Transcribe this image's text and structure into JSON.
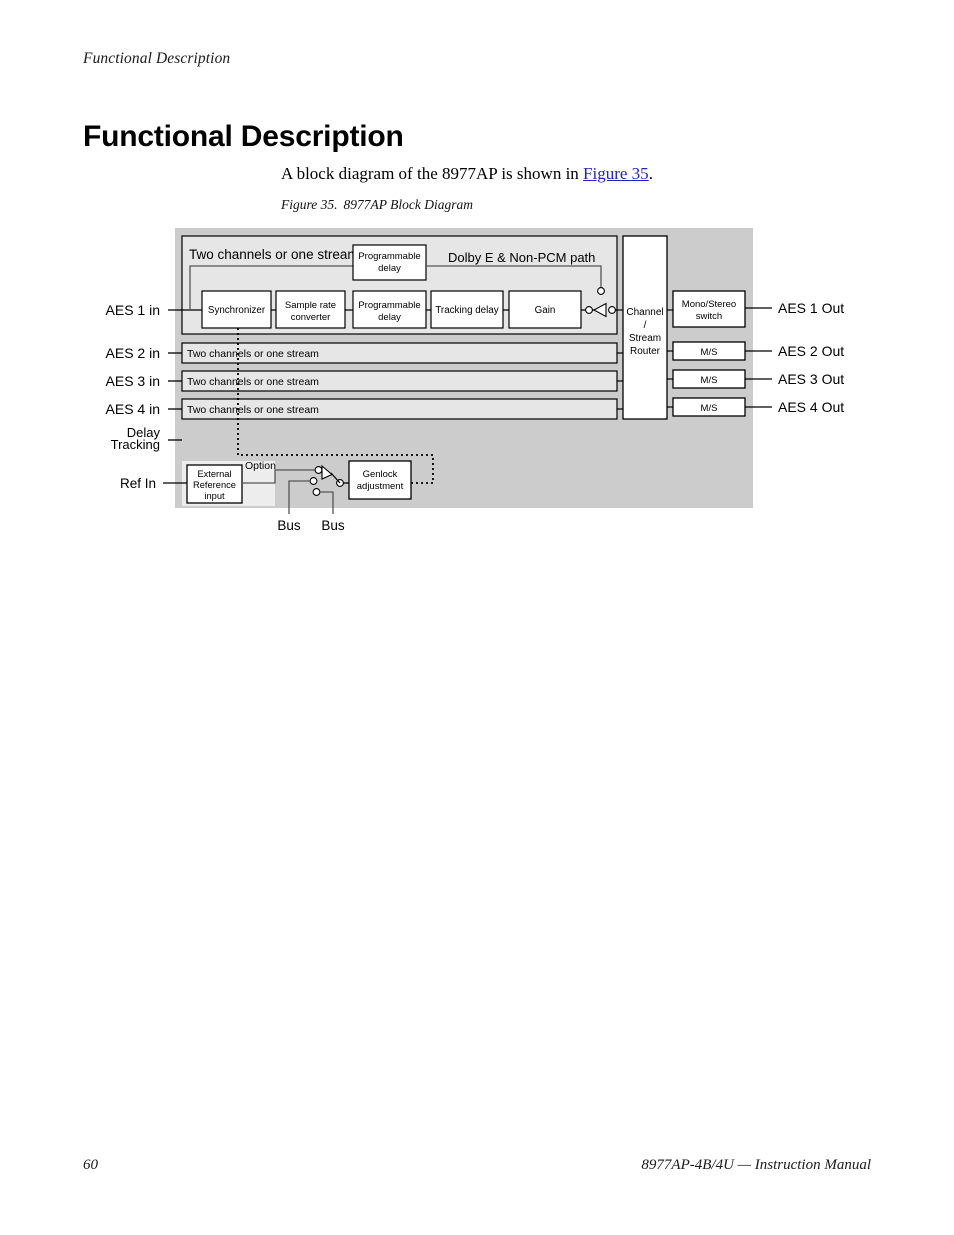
{
  "page": {
    "running_head": "Functional Description",
    "chapter_title": "Functional Description",
    "body_text_before": "A block diagram of the 8977AP is shown in ",
    "body_xref": "Figure 35",
    "body_text_after": ".",
    "caption_number": "Figure 35.",
    "caption_text": "8977AP Block Diagram",
    "footer_page_number": "60",
    "footer_title": "8977AP-4B/4U — Instruction Manual"
  },
  "colors": {
    "panel_gray": "#cccccc",
    "channel_gray": "#e6e6e6",
    "option_gray": "#ededed",
    "block_fill": "#ffffff",
    "line": "#000000",
    "soft_line": "#555555",
    "xref_blue": "#2222cc"
  },
  "diagram": {
    "title": "8977AP Block Diagram",
    "inputs": [
      {
        "label": "AES 1 in"
      },
      {
        "label": "AES 2 in"
      },
      {
        "label": "AES 3 in"
      },
      {
        "label": "AES 4 in"
      }
    ],
    "delay_tracking_label_line1": "Delay",
    "delay_tracking_label_line2": "Tracking",
    "ref_in_label": "Ref In",
    "outputs": [
      {
        "label": "AES 1 Out"
      },
      {
        "label": "AES 2 Out"
      },
      {
        "label": "AES 3 Out"
      },
      {
        "label": "AES 4 Out"
      }
    ],
    "channel_rows": [
      {
        "label": "Two channels or one stream",
        "expanded": true
      },
      {
        "label": "Two channels or one stream",
        "expanded": false
      },
      {
        "label": "Two channels or one stream",
        "expanded": false
      },
      {
        "label": "Two channels or one stream",
        "expanded": false
      }
    ],
    "signal_chain": [
      {
        "label": "Synchronizer"
      },
      {
        "label_line1": "Sample rate",
        "label_line2": "converter"
      },
      {
        "label_line1": "Programmable",
        "label_line2": "delay"
      },
      {
        "label": "Tracking delay"
      },
      {
        "label": "Gain"
      }
    ],
    "bypass_block": {
      "label_line1": "Programmable",
      "label_line2": "delay"
    },
    "bypass_path_label": "Dolby E &  Non-PCM path",
    "router": {
      "line1": "Channel",
      "line2": "/",
      "line3": "Stream",
      "line4": "Router"
    },
    "output_blocks": [
      {
        "label_line1": "Mono/Stereo",
        "label_line2": "switch"
      },
      {
        "label": "M/S"
      },
      {
        "label": "M/S"
      },
      {
        "label": "M/S"
      }
    ],
    "reference_section": {
      "option_label": "Option",
      "external_reference": {
        "line1": "External",
        "line2": "Reference",
        "line3": "input"
      },
      "genlock": {
        "line1": "Genlock",
        "line2": "adjustment"
      },
      "bus_labels": [
        "Bus",
        "Bus"
      ]
    }
  }
}
